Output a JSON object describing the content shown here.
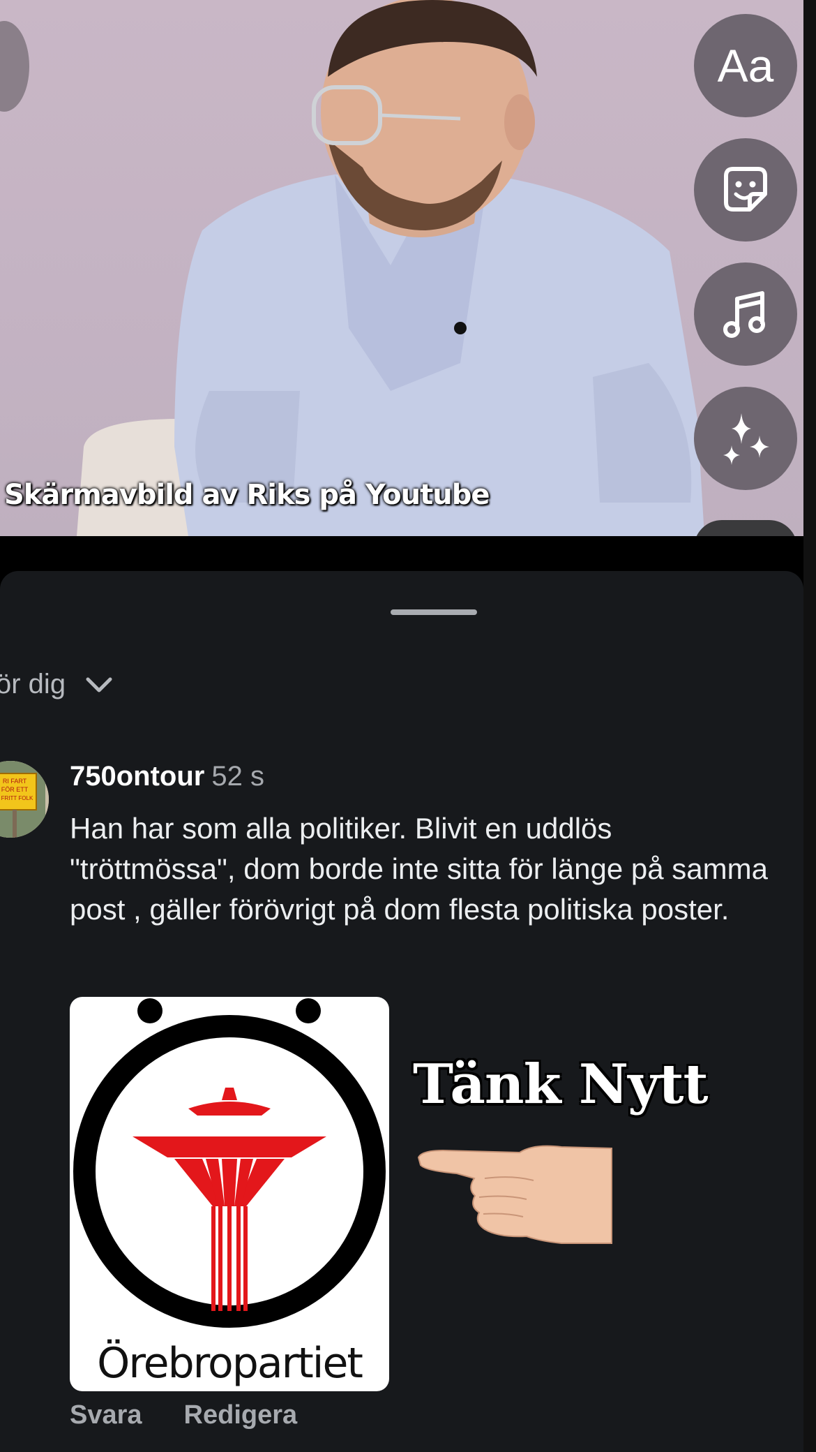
{
  "story": {
    "caption": "Skärmavbild av Riks på Youtube",
    "tools": [
      {
        "id": "text",
        "label": "Aa",
        "icon": "text-icon"
      },
      {
        "id": "sticker",
        "icon": "sticker-icon"
      },
      {
        "id": "music",
        "icon": "music-note-icon"
      },
      {
        "id": "effects",
        "icon": "sparkles-icon"
      }
    ]
  },
  "sheet": {
    "filter_label": "ör dig",
    "comment": {
      "username": "750ontour",
      "time": "52 s",
      "text": "Han har som alla politiker. Blivit en uddlös \"tröttmössa\", dom borde inte sitta för länge på samma post , gäller förövrigt på dom flesta politiska poster.",
      "attachment": {
        "logo_text": "Örebropartiet",
        "overlay_text": "Tänk Nytt"
      },
      "avatar_sign": [
        "RI FART",
        "FÖR ETT",
        "T FRITT FOLK"
      ],
      "actions": {
        "reply": "Svara",
        "edit": "Redigera"
      }
    }
  },
  "colors": {
    "sheet_bg": "#17191c",
    "tool_button": "#6e6670",
    "logo_red": "#e3171b"
  }
}
